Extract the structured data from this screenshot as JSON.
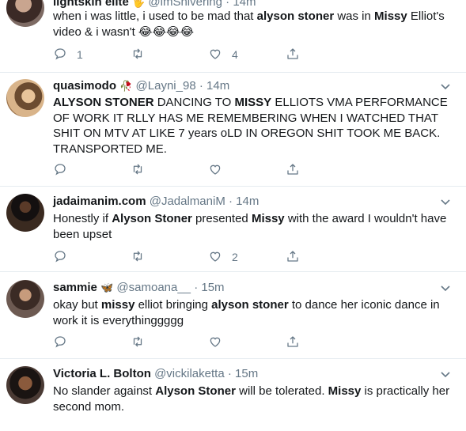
{
  "tweets": [
    {
      "name": "lightskin elite",
      "name_emoji": "🖐",
      "handle": "@lmShivering",
      "time": "14m",
      "body": [
        "when i was little, i used to be mad that ",
        {
          "b": "alyson stoner"
        },
        " was in ",
        {
          "b": "Missy"
        },
        " Elliot's video & i wasn't 😂😂😂😂"
      ],
      "reply_count": "1",
      "retweet_count": "",
      "like_count": "4"
    },
    {
      "name": "quasimodo",
      "name_emoji": "🥀",
      "handle": "@Layni_98",
      "time": "14m",
      "body": [
        {
          "b": "ALYSON STONER"
        },
        " DANCING TO ",
        {
          "b": "MISSY"
        },
        " ELLIOTS VMA PERFORMANCE OF WORK IT RLLY HAS ME REMEMBERING WHEN I WATCHED THAT SHIT ON MTV AT LIKE 7 years oLD IN OREGON SHIT TOOK ME BACK. TRANSPORTED ME."
      ],
      "reply_count": "",
      "retweet_count": "",
      "like_count": ""
    },
    {
      "name": "jadaimanim.com",
      "name_emoji": "",
      "handle": "@JadalmaniM",
      "time": "14m",
      "body": [
        "Honestly if ",
        {
          "b": "Alyson Stoner"
        },
        " presented ",
        {
          "b": "Missy"
        },
        " with the award I wouldn't have been upset"
      ],
      "reply_count": "",
      "retweet_count": "",
      "like_count": "2"
    },
    {
      "name": "sammie",
      "name_emoji": "🦋",
      "handle": "@samoana__",
      "time": "15m",
      "body": [
        "okay but ",
        {
          "b": "missy"
        },
        " elliot bringing ",
        {
          "b": "alyson stoner"
        },
        " to dance her iconic dance in work it is everythinggggg"
      ],
      "reply_count": "",
      "retweet_count": "",
      "like_count": ""
    },
    {
      "name": "Victoria L. Bolton",
      "name_emoji": "",
      "handle": "@vickilaketta",
      "time": "15m",
      "body": [
        "No slander against ",
        {
          "b": "Alyson Stoner"
        },
        " will be tolerated. ",
        {
          "b": "Missy"
        },
        " is practically her second mom."
      ],
      "reply_count": "",
      "retweet_count": "",
      "like_count": ""
    }
  ],
  "separator": "·",
  "colors": {
    "text": "#14171a",
    "muted": "#657786",
    "border": "#e6ecf0"
  },
  "icons": [
    "reply-icon",
    "retweet-icon",
    "like-icon",
    "share-icon",
    "chevron-down-icon",
    "avatar"
  ]
}
